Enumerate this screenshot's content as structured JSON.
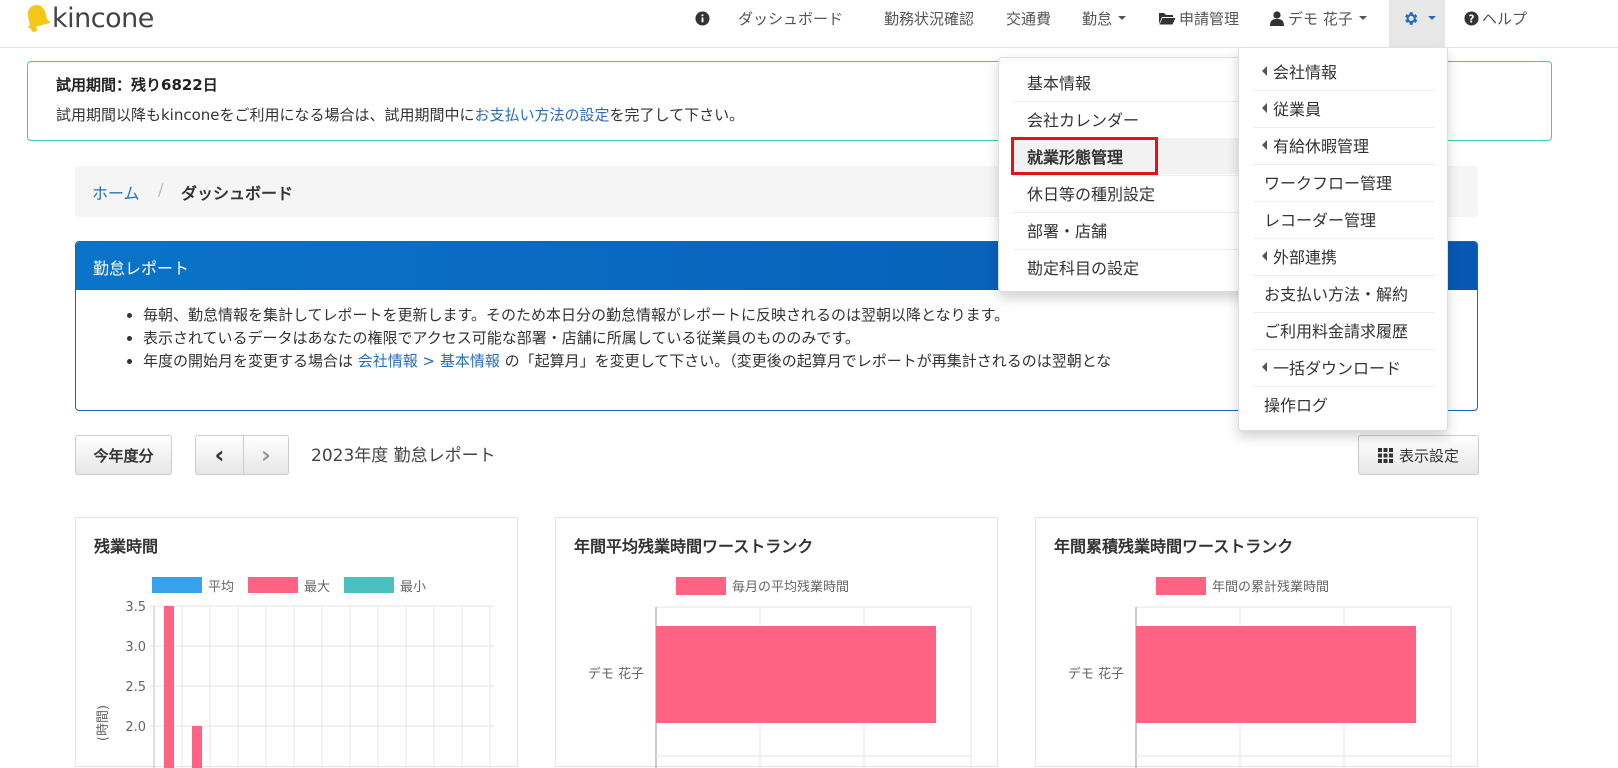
{
  "brand": {
    "name": "kincone"
  },
  "nav": {
    "dashboard": "ダッシュボード",
    "work_status": "勤務状況確認",
    "transport": "交通費",
    "attendance": "勤怠",
    "applications": "申請管理",
    "user": "デモ 花子",
    "help": "ヘルプ"
  },
  "trial": {
    "title": "試用期間：残り6822日",
    "text_before": "試用期間以降もkinconeをご利用になる場合は、試用期間中に",
    "link": "お支払い方法の設定",
    "text_after": "を完了して下さい。"
  },
  "breadcrumb": {
    "home": "ホーム",
    "separator": "/",
    "current": "ダッシュボード"
  },
  "report_panel": {
    "title": "勤怠レポート",
    "bullets": [
      "毎朝、勤怠情報を集計してレポートを更新します。そのため本日分の勤怠情報がレポートに反映されるのは翌朝以降となります。",
      "表示されているデータはあなたの権限でアクセス可能な部署・店舗に所属している従業員のもののみです。"
    ],
    "bullet3_before": "年度の開始月を変更する場合は ",
    "bullet3_link": "会社情報 > 基本情報",
    "bullet3_after": " の「起算月」を変更して下さい。（変更後の起算月でレポートが再集計されるのは翌朝とな"
  },
  "toolbar": {
    "this_year": "今年度分",
    "prev": "‹",
    "next": "›",
    "year_label": "2023年度 勤怠レポート",
    "display_settings": "表示設定"
  },
  "settings_menu_left": {
    "items": [
      "基本情報",
      "会社カレンダー",
      "就業形態管理",
      "休日等の種別設定",
      "部署・店舗",
      "勘定科目の設定"
    ],
    "highlighted": "就業形態管理"
  },
  "settings_menu_right": {
    "items": [
      {
        "label": "会社情報",
        "submenu": true
      },
      {
        "label": "従業員",
        "submenu": true
      },
      {
        "label": "有給休暇管理",
        "submenu": true
      },
      {
        "label": "ワークフロー管理",
        "submenu": false
      },
      {
        "label": "レコーダー管理",
        "submenu": false
      },
      {
        "label": "外部連携",
        "submenu": true
      },
      {
        "label": "お支払い方法・解約",
        "submenu": false
      },
      {
        "label": "ご利用料金請求履歴",
        "submenu": false
      },
      {
        "label": "一括ダウンロード",
        "submenu": true
      },
      {
        "label": "操作ログ",
        "submenu": false
      }
    ]
  },
  "colors": {
    "accent": "#2a6ebb",
    "panel": "#0a68c0",
    "alert_border": "#3ec9c2",
    "highlight": "#e0151b"
  },
  "chart_data": [
    {
      "type": "bar",
      "title": "残業時間",
      "ylabel": "(時間)",
      "legend": [
        "平均",
        "最大",
        "最小"
      ],
      "series": [
        {
          "name": "平均",
          "color": "#36a2eb",
          "values": []
        },
        {
          "name": "最大",
          "color": "#ff6384",
          "values": [
            3.5,
            2.0
          ]
        },
        {
          "name": "最小",
          "color": "#4bc0c0",
          "values": []
        }
      ],
      "y_ticks": [
        "3.5",
        "3.0",
        "2.5",
        "2.0"
      ],
      "ylim": [
        2.0,
        3.5
      ],
      "grid": true,
      "legend_position": "top"
    },
    {
      "type": "bar",
      "orientation": "horizontal",
      "title": "年間平均残業時間ワーストランク",
      "series": [
        {
          "name": "毎月の平均残業時間",
          "color": "#ff6384",
          "values": [
            1
          ]
        }
      ],
      "categories": [
        "デモ 花子"
      ],
      "legend_position": "top"
    },
    {
      "type": "bar",
      "orientation": "horizontal",
      "title": "年間累積残業時間ワーストランク",
      "series": [
        {
          "name": "年間の累計残業時間",
          "color": "#ff6384",
          "values": [
            1
          ]
        }
      ],
      "categories": [
        "デモ 花子"
      ],
      "legend_position": "top"
    }
  ]
}
